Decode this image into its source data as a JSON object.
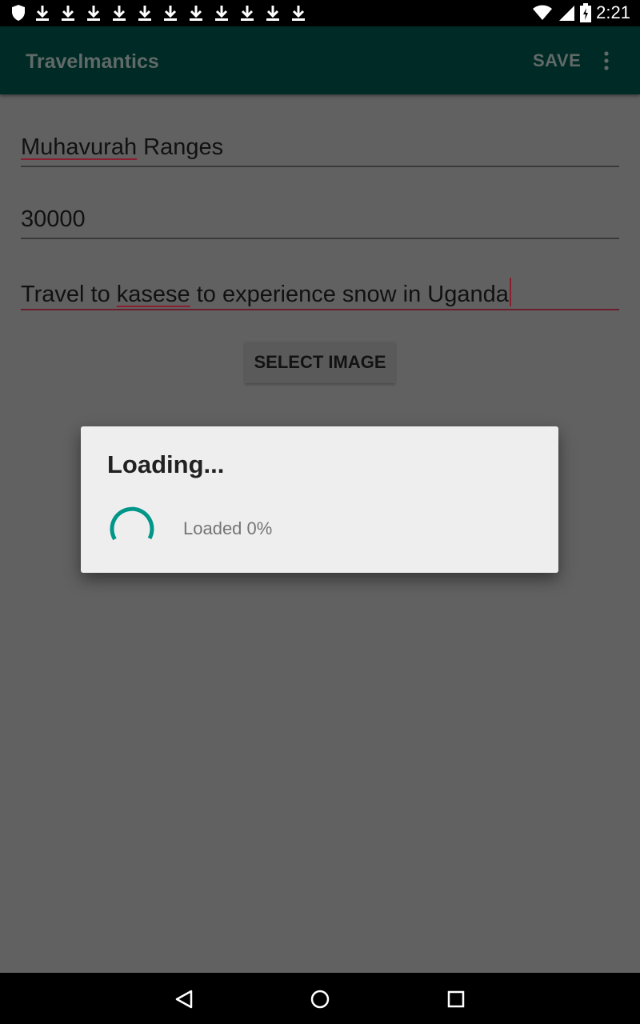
{
  "status_bar": {
    "time": "2:21",
    "left_icons": [
      "shield-icon",
      "download-icon",
      "download-icon",
      "download-icon",
      "download-icon",
      "download-icon",
      "download-icon",
      "download-icon",
      "download-icon",
      "download-icon",
      "download-icon",
      "download-icon"
    ],
    "right_icons": [
      "wifi-icon",
      "signal-icon",
      "battery-charging-icon"
    ]
  },
  "app_bar": {
    "title": "Travelmantics",
    "save_label": "SAVE",
    "overflow_icon": "more-vert-icon"
  },
  "form": {
    "title_field": {
      "misspelled": "Muhavurah",
      "rest": " Ranges"
    },
    "price_field": {
      "value": "30000"
    },
    "description_field": {
      "before": "Travel to ",
      "misspelled": "kasese",
      "after": " to experience snow in Uganda"
    },
    "select_image_label": "SELECT IMAGE"
  },
  "dialog": {
    "title": "Loading...",
    "message": "Loaded 0%",
    "spinner_color": "#009688"
  },
  "nav_bar": {
    "icons": [
      "back-icon",
      "home-icon",
      "recents-icon"
    ]
  },
  "colors": {
    "app_bar": "#002a25",
    "scrim_background": "#616161",
    "accent": "#009688",
    "spell_error": "#8b1e2e"
  }
}
